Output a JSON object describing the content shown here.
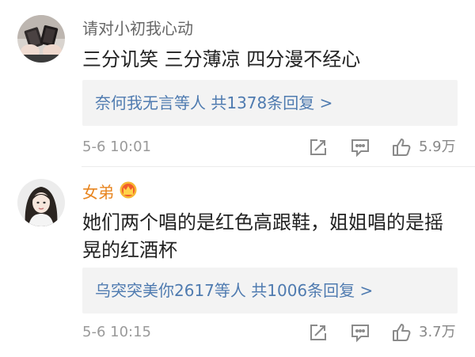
{
  "comments": [
    {
      "username": "请对小初我心动",
      "avatar": "avatar-hands-cards",
      "content": [
        "三分讥笑 三分薄凉 四分漫不经心"
      ],
      "reply_summary": "奈何我无言等人  共1378条回复 >",
      "timestamp": "5-6 10:01",
      "like_count": "5.9万"
    },
    {
      "username": "女弟",
      "avatar": "avatar-girl-portrait",
      "badge": "vip-crown-badge",
      "content": [
        "她们两个唱的是红色高跟鞋，姐姐唱的是摇",
        "晃的红酒杯"
      ],
      "reply_summary": "乌突突美你2617等人  共1006条回复 >",
      "timestamp": "5-6 10:15",
      "like_count": "3.7万"
    }
  ],
  "colors": {
    "link_blue": "#4f7bb0",
    "vip_orange": "#e8851f",
    "reply_bg": "#f3f3f3",
    "meta_gray": "#9a9a9a"
  }
}
